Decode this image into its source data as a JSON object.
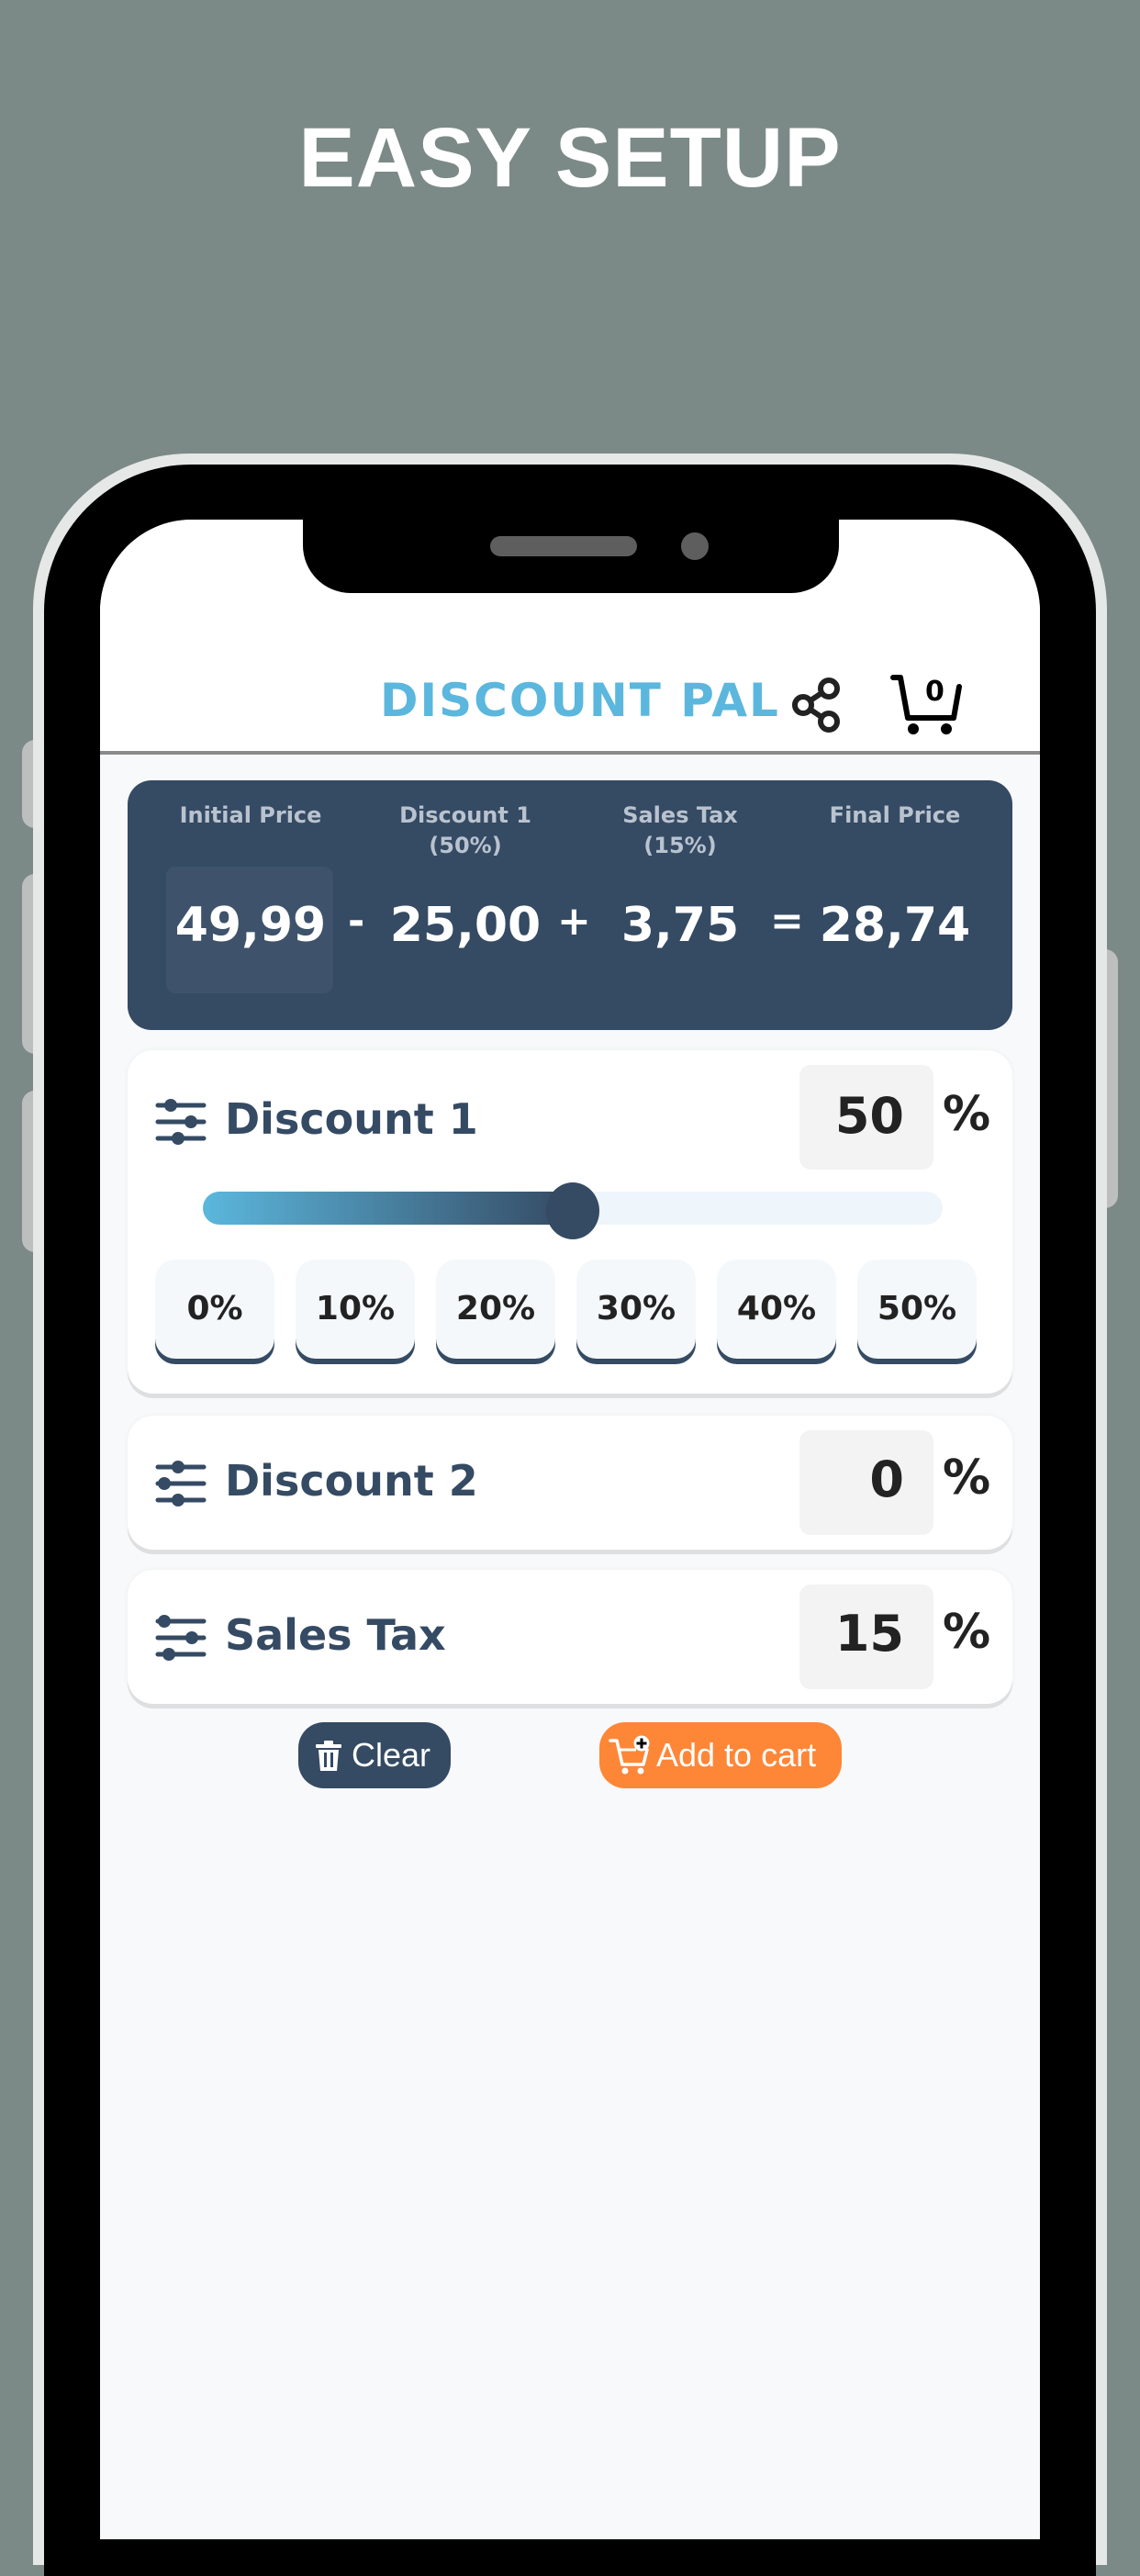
{
  "headline": "EASY SETUP",
  "app": {
    "title": "DISCOUNT PAL",
    "cart_count": "0",
    "icons": {
      "share": "share-icon",
      "cart": "cart-icon"
    }
  },
  "summary": {
    "columns": [
      {
        "label": "Initial Price",
        "sub": "",
        "value": "49,99"
      },
      {
        "label": "Discount 1",
        "sub": "(50%)",
        "value": "25,00"
      },
      {
        "label": "Sales Tax",
        "sub": "(15%)",
        "value": "3,75"
      },
      {
        "label": "Final Price",
        "sub": "",
        "value": "28,74"
      }
    ],
    "operators": [
      "-",
      "+",
      "="
    ]
  },
  "discount1": {
    "title": "Discount 1",
    "value": "50",
    "unit": "%",
    "slider_fraction": 0.5,
    "presets": [
      "0%",
      "10%",
      "20%",
      "30%",
      "40%",
      "50%"
    ]
  },
  "discount2": {
    "title": "Discount 2",
    "value": "0",
    "unit": "%"
  },
  "sales_tax": {
    "title": "Sales Tax",
    "value": "15",
    "unit": "%"
  },
  "buttons": {
    "clear": "Clear",
    "add_to_cart": "Add to cart"
  },
  "colors": {
    "background": "#7b8a86",
    "brand_blue": "#5bb7dd",
    "navy": "#354a63",
    "orange": "#fe8637"
  }
}
